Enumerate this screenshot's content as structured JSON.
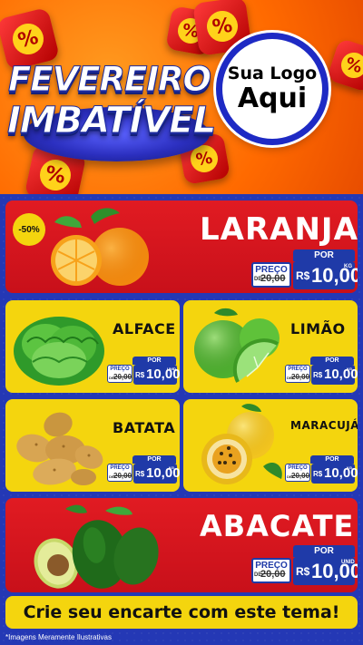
{
  "header": {
    "title_line1": "FEVEREIRO",
    "title_line2": "IMBATÍVEL",
    "percent_symbol": "%",
    "logo_line1": "Sua Logo",
    "logo_line2": "Aqui"
  },
  "colors": {
    "header_orange": "#ff6a00",
    "brand_blue": "#1f3aa8",
    "card_red": "#e11b22",
    "card_yellow": "#f4d50e"
  },
  "products": [
    {
      "name": "LARANJA",
      "badge": "-50%",
      "por": "POR",
      "preco": "PREÇO",
      "old_prefix": "DE",
      "old_price": "20,00",
      "currency": "R$",
      "price": "10,00",
      "unit": "KG"
    },
    {
      "name": "ALFACE",
      "por": "POR",
      "preco": "PREÇO",
      "old_prefix": "DE",
      "old_price": "20,00",
      "currency": "R$",
      "price": "10,00",
      "unit": "UNID"
    },
    {
      "name": "LIMÃO",
      "por": "POR",
      "preco": "PREÇO",
      "old_prefix": "DE",
      "old_price": "20,00",
      "currency": "R$",
      "price": "10,00",
      "unit": "KG"
    },
    {
      "name": "BATATA",
      "por": "POR",
      "preco": "PREÇO",
      "old_prefix": "DE",
      "old_price": "20,00",
      "currency": "R$",
      "price": "10,00",
      "unit": "KG"
    },
    {
      "name": "MARACUJÁ",
      "por": "POR",
      "preco": "PREÇO",
      "old_prefix": "DE",
      "old_price": "20,00",
      "currency": "R$",
      "price": "10,00",
      "unit": "KG"
    },
    {
      "name": "ABACATE",
      "por": "POR",
      "preco": "PREÇO",
      "old_prefix": "DE",
      "old_price": "20,00",
      "currency": "R$",
      "price": "10,00",
      "unit": "UNID"
    }
  ],
  "footer": {
    "banner": "Crie seu encarte com este tema!",
    "disclaimer": "*Imagens Meramente Ilustrativas"
  }
}
